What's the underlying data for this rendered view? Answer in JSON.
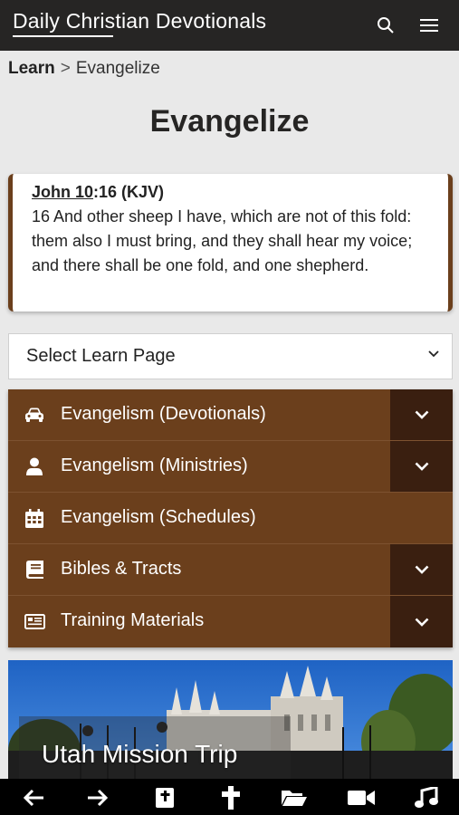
{
  "header": {
    "title": "Daily Christian Devotionals",
    "search_icon": "search-icon",
    "menu_icon": "hamburger-menu-icon"
  },
  "breadcrumb": {
    "root": "Learn",
    "separator": ">",
    "current": "Evangelize"
  },
  "page_title": "Evangelize",
  "verse": {
    "book": "John 10",
    "ref_rest": ":16 (KJV)",
    "text": "16 And other sheep I have, which are not of this fold: them also I must bring, and they shall hear my voice; and there shall be one fold, and one shepherd."
  },
  "select": {
    "value": "Select Learn Page"
  },
  "menu": {
    "items": [
      {
        "label": "Evangelism (Devotionals)",
        "icon": "car-icon",
        "expandable": true
      },
      {
        "label": "Evangelism (Ministries)",
        "icon": "person-icon",
        "expandable": true
      },
      {
        "label": "Evangelism (Schedules)",
        "icon": "calendar-icon",
        "expandable": false
      },
      {
        "label": "Bibles & Tracts",
        "icon": "book-icon",
        "expandable": true
      },
      {
        "label": "Training Materials",
        "icon": "newspaper-icon",
        "expandable": true
      }
    ]
  },
  "feature": {
    "caption": "Utah Mission Trip"
  },
  "bottom_nav": {
    "items": [
      "arrow-left-icon",
      "arrow-right-icon",
      "bible-icon",
      "cross-icon",
      "folder-icon",
      "video-icon",
      "music-icon"
    ]
  },
  "colors": {
    "header_bg": "#262524",
    "accent_brown": "#6b3f1c",
    "toggle_dark": "#3a1f10",
    "page_bg": "#e9e9e9"
  }
}
